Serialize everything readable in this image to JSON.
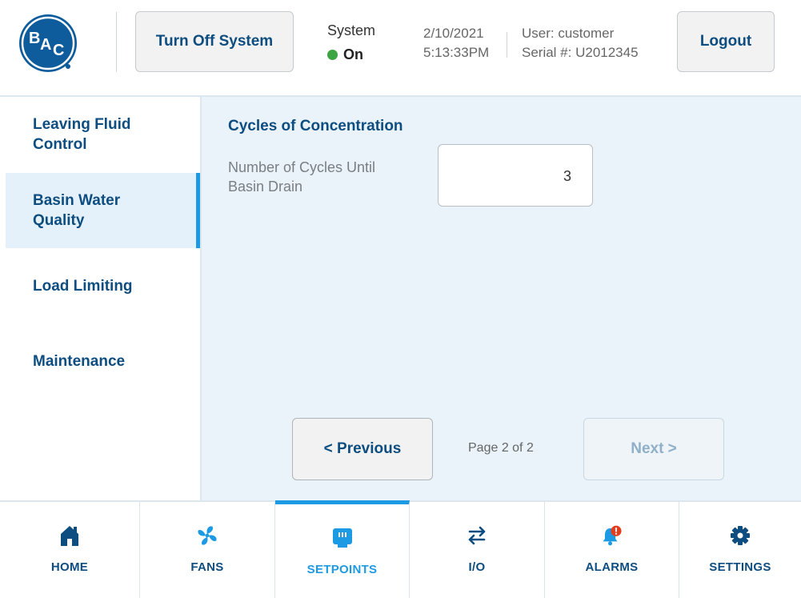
{
  "header": {
    "logo_text": "BAC",
    "turn_off_label": "Turn Off System",
    "system_label": "System",
    "system_status": "On",
    "date": "2/10/2021",
    "time": "5:13:33PM",
    "user": "User: customer",
    "serial": "Serial #: U2012345",
    "logout_label": "Logout"
  },
  "sidebar": {
    "items": [
      {
        "label": "Leaving Fluid Control",
        "active": false
      },
      {
        "label": "Basin Water Quality",
        "active": true
      },
      {
        "label": "Load Limiting",
        "active": false
      },
      {
        "label": "Maintenance",
        "active": false
      }
    ]
  },
  "main": {
    "section_title": "Cycles of Concentration",
    "field_label": "Number of Cycles Until Basin Drain",
    "field_value": "3"
  },
  "pager": {
    "prev_label": "< Previous",
    "page_text": "Page 2 of 2",
    "next_label": "Next >"
  },
  "bottom_nav": {
    "items": [
      {
        "label": "HOME",
        "icon": "home-icon"
      },
      {
        "label": "FANS",
        "icon": "fan-icon"
      },
      {
        "label": "SETPOINTS",
        "icon": "setpoints-icon",
        "active": true
      },
      {
        "label": "I/O",
        "icon": "io-arrows-icon"
      },
      {
        "label": "ALARMS",
        "icon": "alarm-bell-icon"
      },
      {
        "label": "SETTINGS",
        "icon": "gear-icon"
      }
    ]
  },
  "colors": {
    "brand_navy": "#0e4d80",
    "accent_blue": "#1c9ae3",
    "status_green": "#3ca442",
    "alarm_red": "#e53d1c",
    "content_bg": "#e9f3f9"
  }
}
